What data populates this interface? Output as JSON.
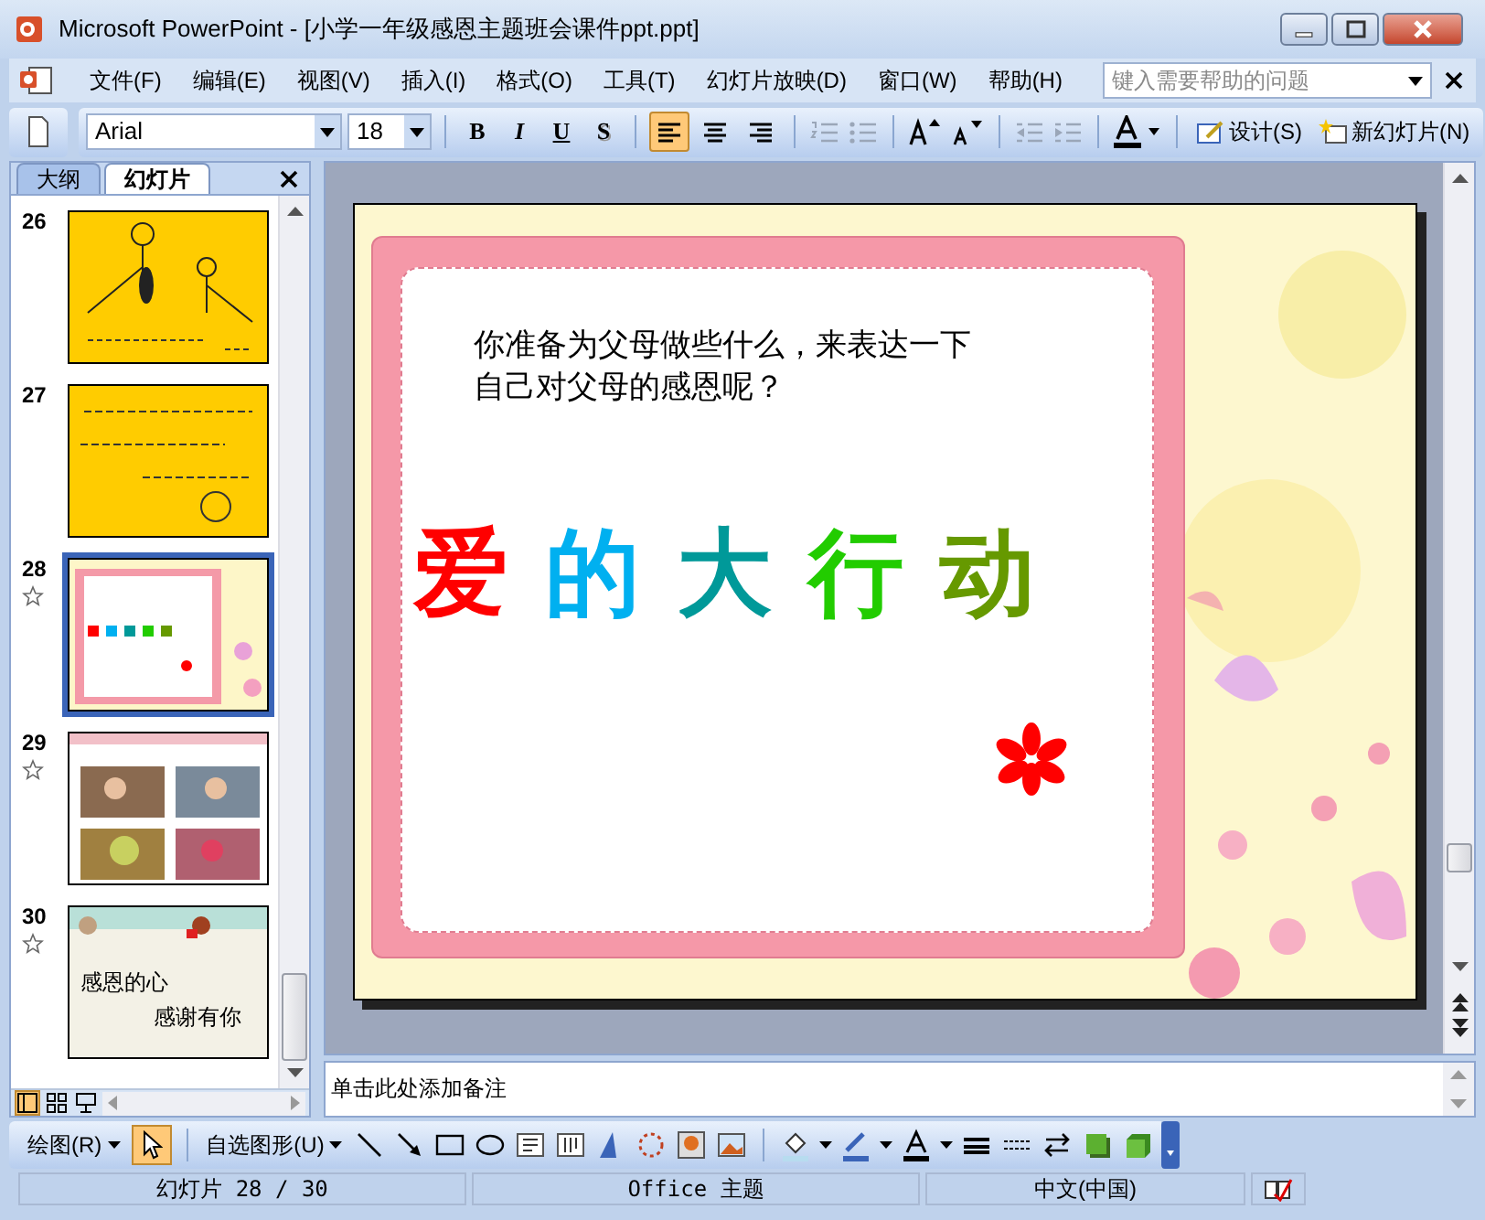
{
  "window": {
    "title": "Microsoft PowerPoint - [小学一年级感恩主题班会课件ppt.ppt]"
  },
  "menu": {
    "items": [
      "文件(F)",
      "编辑(E)",
      "视图(V)",
      "插入(I)",
      "格式(O)",
      "工具(T)",
      "幻灯片放映(D)",
      "窗口(W)",
      "帮助(H)"
    ],
    "help_placeholder": "键入需要帮助的问题"
  },
  "toolbar": {
    "font": "Arial",
    "size": "18",
    "styles": [
      "B",
      "I",
      "U",
      "S"
    ],
    "align": [
      {
        "selected": true
      },
      {
        "selected": false
      },
      {
        "selected": false
      }
    ],
    "buttons": [
      "设计(S)",
      "新幻灯片(N)"
    ]
  },
  "pane": {
    "tabs": [
      {
        "label": "大纲",
        "selected": false
      },
      {
        "label": "幻灯片",
        "selected": true
      }
    ],
    "slides": [
      {
        "number": "26",
        "kind": "doodle",
        "selected": false,
        "animated": false
      },
      {
        "number": "27",
        "kind": "note",
        "selected": false,
        "animated": false
      },
      {
        "number": "28",
        "kind": "frame",
        "selected": true,
        "animated": true
      },
      {
        "number": "29",
        "kind": "photos",
        "selected": false,
        "animated": true
      },
      {
        "number": "30",
        "kind": "text",
        "selected": false,
        "animated": true,
        "lines": [
          "感恩的心",
          "感谢有你"
        ]
      }
    ],
    "views": [
      {
        "selected": true
      },
      {
        "selected": false
      },
      {
        "selected": false
      }
    ]
  },
  "slide": {
    "lines": [
      "你准备为父母做些什么，来表达一下",
      "自己对父母的感恩呢？"
    ],
    "title_chars": [
      {
        "char": "爱",
        "color": "#ff0000"
      },
      {
        "char": "的",
        "color": "#00b0f0"
      },
      {
        "char": "大",
        "color": "#009999"
      },
      {
        "char": "行",
        "color": "#22cc00"
      },
      {
        "char": "动",
        "color": "#669900"
      }
    ]
  },
  "notes": {
    "placeholder": "单击此处添加备注"
  },
  "draw_toolbar": {
    "draw_menu": "绘图(R)",
    "pointer_selected": true,
    "autoshapes": "自选图形(U)"
  },
  "status_bar": [
    "幻灯片 28 / 30",
    "Office 主题",
    "中文(中国)"
  ]
}
